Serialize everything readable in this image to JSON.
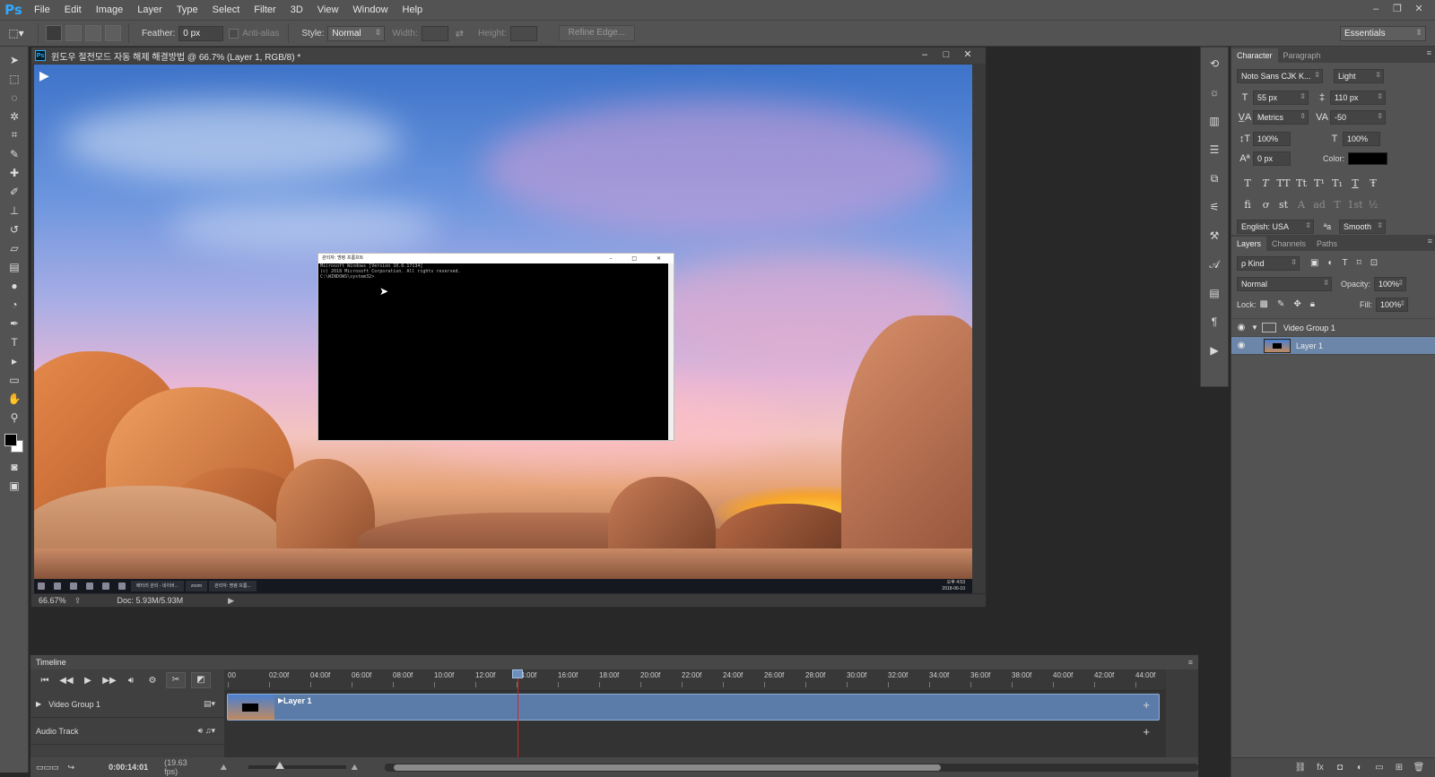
{
  "menubar": {
    "logo": "Ps",
    "items": [
      "File",
      "Edit",
      "Image",
      "Layer",
      "Type",
      "Select",
      "Filter",
      "3D",
      "View",
      "Window",
      "Help"
    ],
    "window_controls": [
      "–",
      "❐",
      "✕"
    ]
  },
  "options": {
    "feather_label": "Feather:",
    "feather_value": "0 px",
    "antialias_label": "Anti-alias",
    "style_label": "Style:",
    "style_value": "Normal",
    "width_label": "Width:",
    "height_label": "Height:",
    "refine_edge": "Refine Edge...",
    "workspace": "Essentials"
  },
  "document": {
    "title": "윈도우 절전모드 자동 해제 해결방법 @ 66.7% (Layer 1, RGB/8) *",
    "ps_icon": "Ps",
    "zoom": "66.67%",
    "doc_size": "Doc: 5.93M/5.93M",
    "status_arrow": "▶"
  },
  "cmd_window": {
    "title": "관리자: 명령 프롬프트",
    "buttons": "–  □  ✕",
    "lines": [
      "Microsoft Windows [Version 10.0.17134]",
      "(c) 2018 Microsoft Corporation. All rights reserved.",
      "",
      "C:\\WINDOWS\\system32>"
    ]
  },
  "taskbar": {
    "apps": [
      "배터리 관리 - 네이버...",
      "zoom",
      "관리자: 명령 프롬..."
    ],
    "clock_time": "오후 4:53",
    "clock_date": "2018-06-10"
  },
  "character": {
    "tab_character": "Character",
    "tab_paragraph": "Paragraph",
    "font_family": "Noto Sans CJK K...",
    "font_style": "Light",
    "font_size": "55 px",
    "leading": "110 px",
    "kerning": "Metrics",
    "tracking": "-50",
    "vertical_scale": "100%",
    "horizontal_scale": "100%",
    "baseline_shift": "0 px",
    "color_label": "Color:",
    "color_value": "#000000",
    "style_buttons": [
      "T",
      "T",
      "TT",
      "Tt",
      "T¹",
      "T₁",
      "T",
      "Ŧ"
    ],
    "opentype_buttons": [
      "fi",
      "ơ",
      "st",
      "A",
      "ad",
      "T",
      "1st",
      "½"
    ],
    "language": "English: USA",
    "aa_icon": "ªa",
    "antialias": "Smooth"
  },
  "layers": {
    "tabs": [
      "Layers",
      "Channels",
      "Paths"
    ],
    "kind_filter": "ρ Kind",
    "blend_mode": "Normal",
    "opacity_label": "Opacity:",
    "opacity": "100%",
    "lock_label": "Lock:",
    "fill_label": "Fill:",
    "fill": "100%",
    "group_name": "Video Group 1",
    "layer_name": "Layer 1"
  },
  "timeline": {
    "title": "Timeline",
    "ticks": [
      "00",
      "02:00f",
      "04:00f",
      "06:00f",
      "08:00f",
      "10:00f",
      "12:00f",
      "14:00f",
      "16:00f",
      "18:00f",
      "20:00f",
      "22:00f",
      "24:00f",
      "26:00f",
      "28:00f",
      "30:00f",
      "32:00f",
      "34:00f",
      "36:00f",
      "38:00f",
      "40:00f",
      "42:00f",
      "44:00f"
    ],
    "video_group": "Video Group 1",
    "audio_track": "Audio Track",
    "clip_name": "Layer 1",
    "timecode": "0:00:14:01",
    "fps": "(19.63 fps)",
    "playhead_seconds": 14.03,
    "duration_seconds": 45
  }
}
